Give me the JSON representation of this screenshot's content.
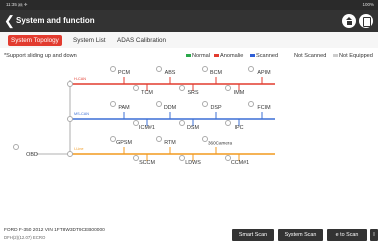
{
  "status_bar": {
    "time": "11:35 ㏂ ✈",
    "battery": "100%"
  },
  "header": {
    "title": "System and function"
  },
  "tabs": [
    {
      "label": "System Topology",
      "active": true
    },
    {
      "label": "System List",
      "active": false
    },
    {
      "label": "ADAS Calibration",
      "active": false
    }
  ],
  "support_note": "*Support sliding up and down",
  "legend": [
    {
      "label": "Normal",
      "color": "#2aa84a"
    },
    {
      "label": "Anomalie",
      "color": "#e23b2f"
    },
    {
      "label": "Scanned",
      "color": "#2f5fd7"
    },
    {
      "label": "Not Scanned",
      "color": ""
    },
    {
      "label": "Not Equipped",
      "color": "#cccccc"
    }
  ],
  "buses": [
    {
      "label": "H-CAN",
      "color": "#e23b2f"
    },
    {
      "label": "MS-CAN",
      "color": "#3b6fd6"
    },
    {
      "label": "I-Line",
      "color": "#f29a1f"
    }
  ],
  "obd_label": "OBD",
  "systems": {
    "pcm": "PCM",
    "abs": "ABS",
    "bcm": "BCM",
    "apim": "APIM",
    "tcm": "TCM",
    "srs": "SRS",
    "imm": "IMM",
    "pam": "PAM",
    "ddm": "DDM",
    "dsp": "DSP",
    "fcim": "FCIM",
    "icm1": "ICM#1",
    "dsm": "DSM",
    "ipc": "IPC",
    "gpsm": "GPSM",
    "rtm": "RTM",
    "camera": "360Camera",
    "sccm": "SCCM",
    "ldws": "LDWS",
    "ccm1": "CCM#1"
  },
  "footer": {
    "vehicle_info": "FORD  F-350  2012  VIN  1FT8W3DT9CEB00000",
    "second_line": "DFH(2)(12.07)   ECRO",
    "buttons": [
      "Smart Scan",
      "System Scan",
      "e to Scan",
      "I"
    ]
  }
}
